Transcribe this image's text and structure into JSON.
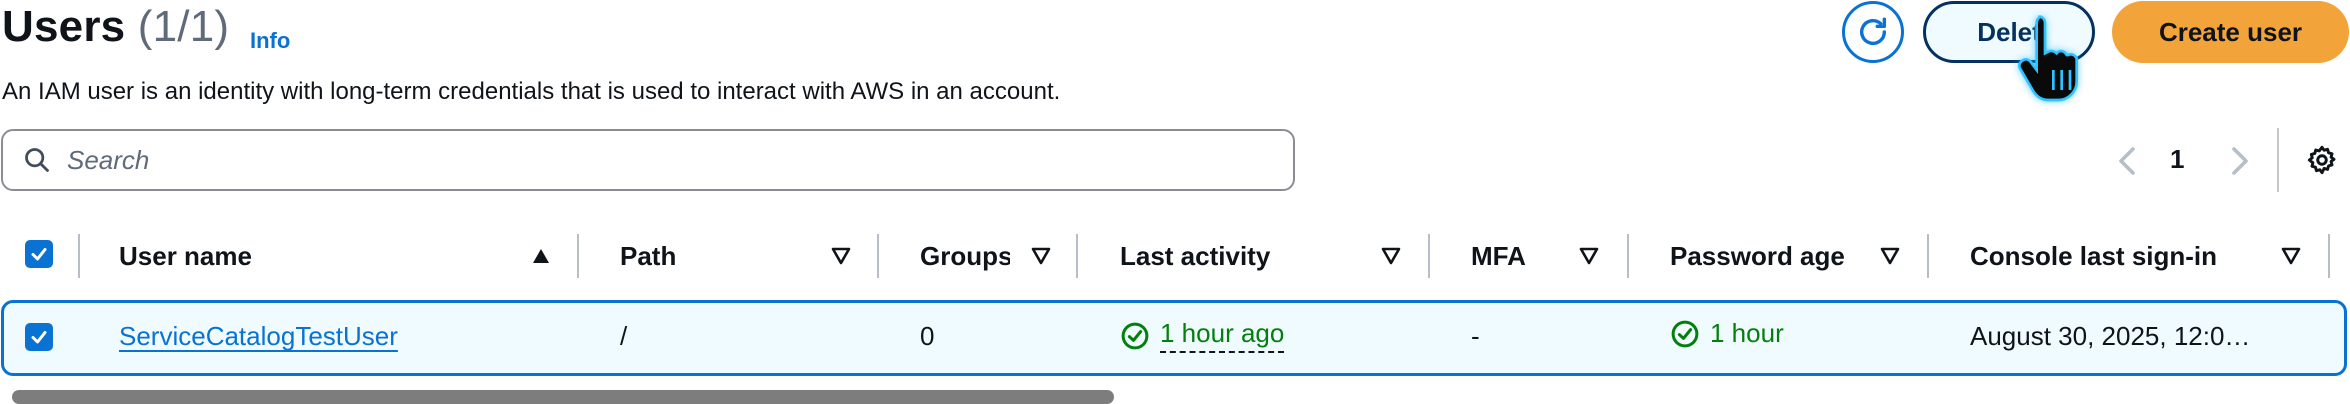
{
  "header": {
    "title": "Users",
    "count": "(1/1)",
    "info_label": "Info",
    "description": "An IAM user is an identity with long-term credentials that is used to interact with AWS in an account."
  },
  "actions": {
    "delete_label": "Delet",
    "create_label": "Create user"
  },
  "search": {
    "placeholder": "Search",
    "value": ""
  },
  "pagination": {
    "current_page": "1"
  },
  "table": {
    "columns": [
      {
        "label": "User name",
        "sort": "ascending"
      },
      {
        "label": "Path",
        "sort": "none"
      },
      {
        "label": "Groups",
        "sort": "none"
      },
      {
        "label": "Last activity",
        "sort": "none"
      },
      {
        "label": "MFA",
        "sort": "none"
      },
      {
        "label": "Password age",
        "sort": "none"
      },
      {
        "label": "Console last sign-in",
        "sort": "none"
      }
    ],
    "rows": [
      {
        "selected": true,
        "user_name": "ServiceCatalogTestUser",
        "path": "/",
        "groups": "0",
        "last_activity": "1 hour ago",
        "mfa": "-",
        "password_age": "1 hour",
        "console_last_sign_in": "August 30, 2025, 12:0…"
      }
    ]
  },
  "colors": {
    "accent": "#0972d3",
    "primary_button": "#f2a33a",
    "success": "#037f0c",
    "selected_row_bg": "#f0fbff"
  }
}
